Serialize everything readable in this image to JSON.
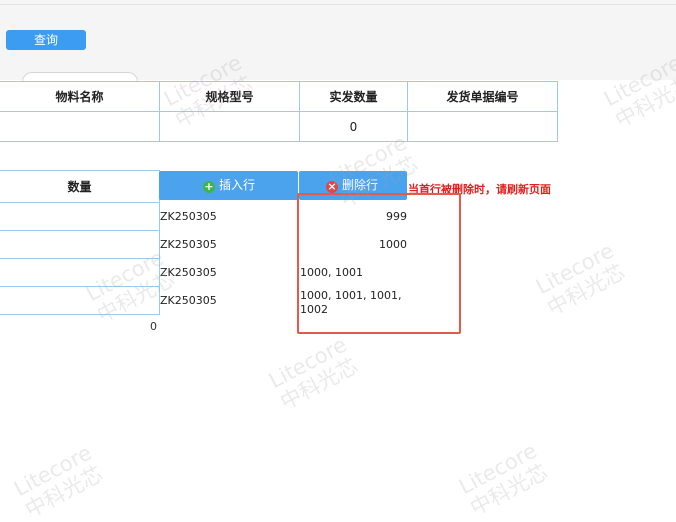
{
  "toolbar": {
    "query_label": "查询"
  },
  "top_table": {
    "headers": [
      "物料名称",
      "规格型号",
      "实发数量",
      "发货单据编号"
    ],
    "row": [
      "",
      "",
      "0",
      ""
    ]
  },
  "bottom_table": {
    "header": "数量",
    "total": "0"
  },
  "actions": {
    "insert_label": "插入行",
    "delete_label": "删除行",
    "warning": "当首行被删除时，请刷新页面"
  },
  "rows": [
    {
      "code": "ZK250305",
      "value": "999"
    },
    {
      "code": "ZK250305",
      "value": "1000"
    },
    {
      "code": "ZK250305",
      "value": "1000, 1001"
    },
    {
      "code": "ZK250305",
      "value": "1000, 1001, 1001, 1002"
    }
  ],
  "watermark": {
    "line1": "Litecore",
    "line2": "中科光芯"
  },
  "colors": {
    "accent": "#4ba3ee",
    "warning": "#e02020",
    "highlight_border": "#e45a4a"
  }
}
